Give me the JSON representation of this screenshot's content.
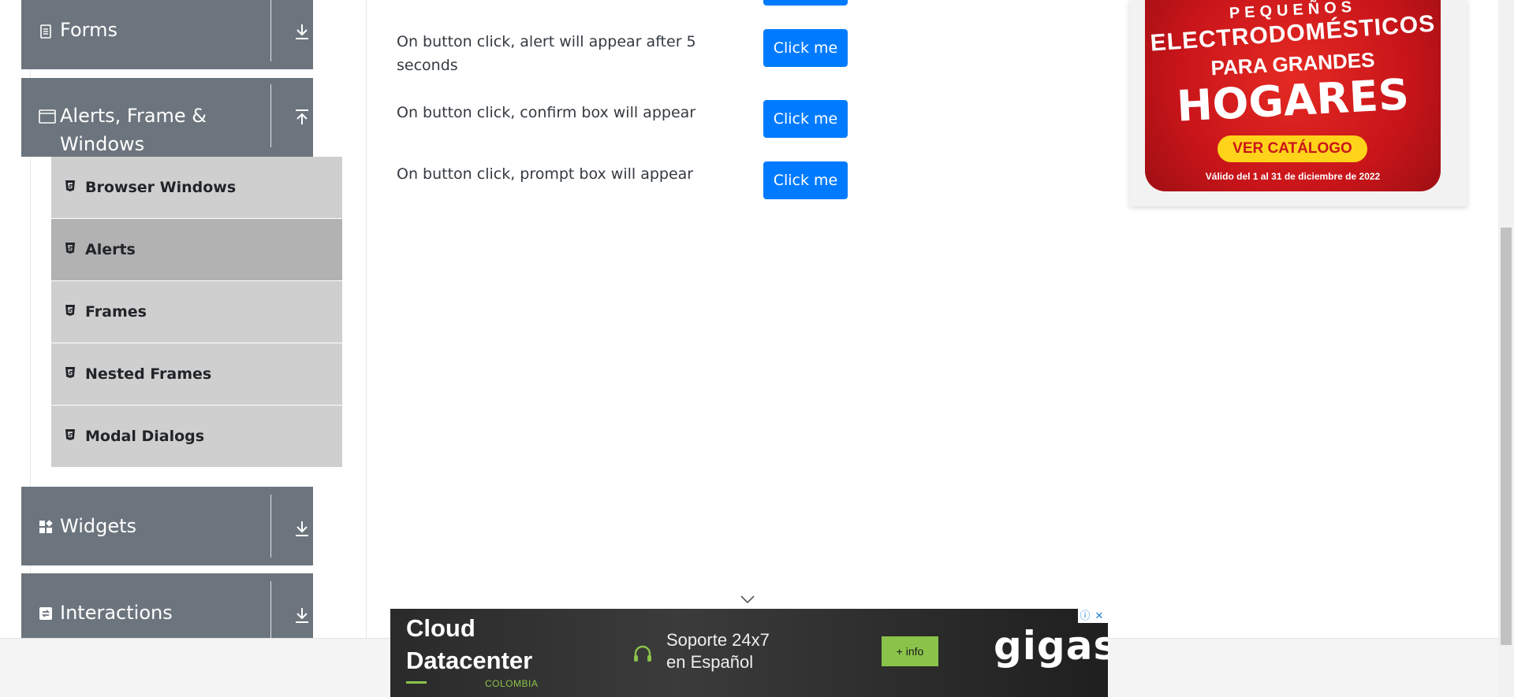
{
  "sidebar": {
    "groups": [
      {
        "label": "Forms",
        "icon": "form-icon",
        "arrow": "download-arrow-icon"
      },
      {
        "label": "Alerts, Frame & Windows",
        "icon": "window-icon",
        "arrow": "upload-arrow-icon"
      },
      {
        "label": "Widgets",
        "icon": "widgets-icon",
        "arrow": "download-arrow-icon"
      },
      {
        "label": "Interactions",
        "icon": "interactions-icon",
        "arrow": "download-arrow-icon"
      }
    ],
    "items": [
      {
        "label": "Browser Windows",
        "active": false
      },
      {
        "label": "Alerts",
        "active": true
      },
      {
        "label": "Frames",
        "active": false
      },
      {
        "label": "Nested Frames",
        "active": false
      },
      {
        "label": "Modal Dialogs",
        "active": false
      }
    ]
  },
  "main": {
    "rows": [
      {
        "text": "On button click, alert will appear after 5 seconds",
        "button": "Click me"
      },
      {
        "text": "On button click, confirm box will appear",
        "button": "Click me"
      },
      {
        "text": "On button click, prompt box will appear",
        "button": "Click me"
      }
    ]
  },
  "ad_right": {
    "line1": "PEQUEÑOS",
    "line2": "ELECTRODOMÉSTICOS",
    "line3": "PARA GRANDES",
    "line4": "HOGARES",
    "cta": "VER CATÁLOGO",
    "footer": "Válido del 1 al 31 de diciembre de 2022"
  },
  "ad_bottom": {
    "title": "Cloud Datacenter",
    "subtitle": "COLOMBIA",
    "support": "Soporte 24x7 en Español",
    "cta": "+ info",
    "brand": "gigas",
    "info_glyph": "ⓘ",
    "close_glyph": "✕"
  },
  "colors": {
    "group_bg": "#6c757d",
    "item_bg": "#cfcfcf",
    "item_active_bg": "#b2b2b2",
    "button_primary": "#007bff",
    "ad_red": "#c9151a",
    "ad_yellow": "#ffd31a",
    "ad_green": "#8bc34a"
  }
}
